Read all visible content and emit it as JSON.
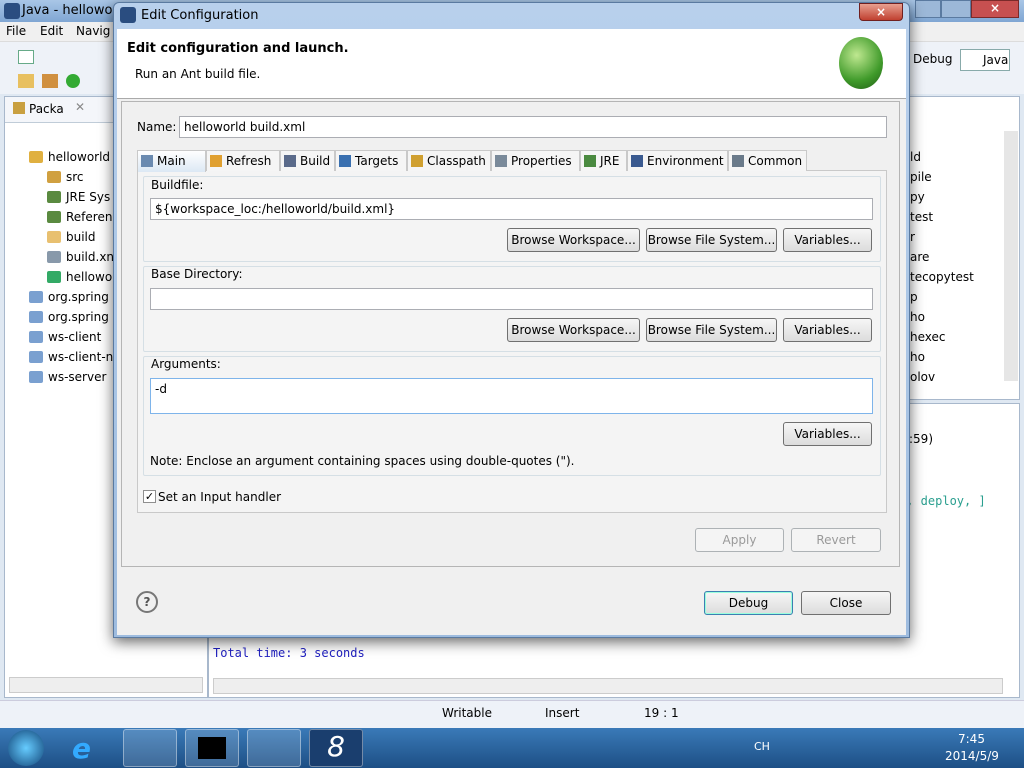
{
  "window": {
    "title": "Java - helloworld",
    "menu": [
      "File",
      "Edit",
      "Navig"
    ],
    "perspectives": [
      "Debug",
      "Java"
    ]
  },
  "package_explorer": {
    "tab": "Packa",
    "items": [
      {
        "label": "helloworld",
        "level": 0
      },
      {
        "label": "src",
        "level": 1
      },
      {
        "label": "JRE Sys",
        "level": 1
      },
      {
        "label": "Referen",
        "level": 1
      },
      {
        "label": "build",
        "level": 1
      },
      {
        "label": "build.xn",
        "level": 1
      },
      {
        "label": "hellowo",
        "level": 1
      },
      {
        "label": "org.spring",
        "level": 0
      },
      {
        "label": "org.spring",
        "level": 0
      },
      {
        "label": "ws-client",
        "level": 0
      },
      {
        "label": "ws-client-n",
        "level": 0
      },
      {
        "label": "ws-server",
        "level": 0
      }
    ]
  },
  "outline": {
    "items": [
      "ld",
      "pile",
      "py",
      "test",
      "r",
      "are",
      "tecopytest",
      "p",
      "ho",
      "hexec",
      "ho",
      "olov"
    ]
  },
  "console": {
    "header": ":59)",
    "line1": "y, deploy, ]",
    "total": "Total time: 3 seconds"
  },
  "status": {
    "writable": "Writable",
    "insert": "Insert",
    "position": "19 : 1"
  },
  "taskbar": {
    "lang": "CH",
    "time": "7:45",
    "date": "2014/5/9"
  },
  "dialog": {
    "title": "Edit Configuration",
    "header_title": "Edit configuration and launch.",
    "header_subtitle": "Run an Ant build file.",
    "name_label": "Name:",
    "name_value": "helloworld build.xml",
    "tabs": [
      "Main",
      "Refresh",
      "Build",
      "Targets",
      "Classpath",
      "Properties",
      "JRE",
      "Environment",
      "Common"
    ],
    "active_tab": "Main",
    "buildfile": {
      "label": "Buildfile:",
      "value": "${workspace_loc:/helloworld/build.xml}"
    },
    "basedir": {
      "label": "Base Directory:",
      "value": ""
    },
    "arguments": {
      "label": "Arguments:",
      "value": "-d",
      "note": "Note: Enclose an argument containing spaces using double-quotes (\")."
    },
    "browse_workspace": "Browse Workspace...",
    "browse_fs": "Browse File System...",
    "variables": "Variables...",
    "input_handler": {
      "label": "Set an Input handler",
      "checked": true
    },
    "apply": "Apply",
    "revert": "Revert",
    "debug": "Debug",
    "close": "Close"
  }
}
